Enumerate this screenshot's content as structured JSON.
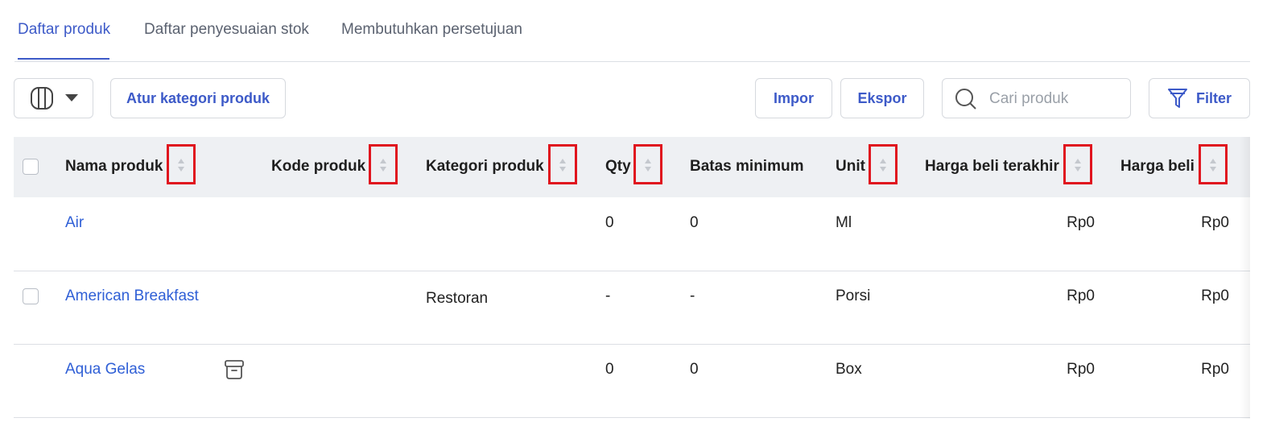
{
  "tabs": [
    {
      "label": "Daftar produk",
      "active": true
    },
    {
      "label": "Daftar penyesuaian stok",
      "active": false
    },
    {
      "label": "Membutuhkan persetujuan",
      "active": false
    }
  ],
  "toolbar": {
    "column_toggle_icon": "columns-icon",
    "category_button": "Atur kategori produk",
    "import_button": "Impor",
    "export_button": "Ekspor",
    "search_placeholder": "Cari produk",
    "filter_button": "Filter"
  },
  "table": {
    "columns": [
      "Nama produk",
      "Kode produk",
      "Kategori produk",
      "Qty",
      "Batas minimum",
      "Unit",
      "Harga beli terakhir",
      "Harga beli"
    ],
    "rows": [
      {
        "name": "Air",
        "code": "",
        "category": "",
        "qty": "0",
        "min": "0",
        "unit": "Ml",
        "last_price": "Rp0",
        "price": "Rp0",
        "checkbox": false,
        "archive_icon": false
      },
      {
        "name": "American Breakfast",
        "code": "",
        "category": "Restoran",
        "qty": "-",
        "min": "-",
        "unit": "Porsi",
        "last_price": "Rp0",
        "price": "Rp0",
        "checkbox": true,
        "archive_icon": false
      },
      {
        "name": "Aqua Gelas",
        "code": "",
        "category": "",
        "qty": "0",
        "min": "0",
        "unit": "Box",
        "last_price": "Rp0",
        "price": "Rp0",
        "checkbox": false,
        "archive_icon": true
      }
    ]
  },
  "colors": {
    "accent": "#3d5ac8",
    "link": "#2f5fd6",
    "highlight": "#e0141e",
    "header_bg": "#eef0f3"
  }
}
